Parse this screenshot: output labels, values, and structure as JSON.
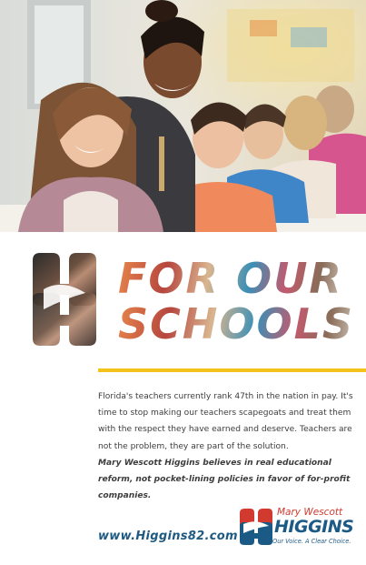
{
  "headline": {
    "line1": "FOR OUR",
    "line2": "SCHOOLS"
  },
  "body": {
    "paragraph1": "Florida's teachers currently rank 47th in the nation in pay. It's time to stop making our teachers scapegoats and treat them with the respect they have earned and deserve. Teachers are not the problem, they are part of the solution.",
    "emphasis": "Mary Wescott Higgins believes in real educational reform, not pocket-lining policies in favor of for-profit companies."
  },
  "footer": {
    "url": "www.Higgins82.com"
  },
  "brand": {
    "first_names": "Mary Wescott",
    "surname": "HIGGINS",
    "tagline": "Our Voice. A Clear Choice."
  },
  "colors": {
    "navy": "#1c5a86",
    "red": "#d23a30",
    "yellow": "#f3c21c"
  },
  "icons": {
    "logo_mark": "double-h-monogram-icon",
    "brand_mark": "higgins-monogram-icon"
  }
}
